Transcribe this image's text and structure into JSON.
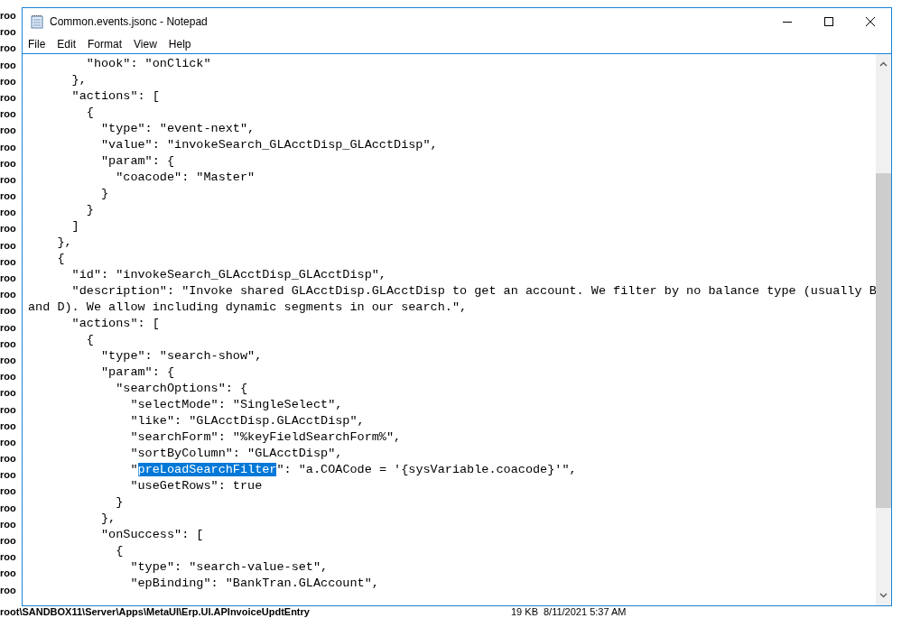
{
  "background_list": {
    "items": [
      "roo",
      "roo",
      "roo",
      "roo",
      "roo",
      "roo",
      "roo",
      "roo",
      "roo",
      "roo",
      "roo",
      "roo",
      "roo",
      "roo",
      "roo",
      "roo",
      "roo",
      "roo",
      "roo",
      "roo",
      "roo",
      "roo",
      "roo",
      "roo",
      "roo",
      "roo",
      "roo",
      "roo",
      "roo",
      "roo",
      "roo",
      "roo",
      "roo",
      "roo",
      "roo",
      "roo"
    ],
    "last_row": {
      "path": "root\\SANDBOX11\\Server\\Apps\\MetaUI\\Erp.UI.APInvoiceUpdtEntry",
      "size": "19 KB",
      "date": "8/11/2021 5:37 AM"
    }
  },
  "window": {
    "title": "Common.events.jsonc - Notepad",
    "menu": [
      "File",
      "Edit",
      "Format",
      "View",
      "Help"
    ],
    "lines": [
      {
        "text": "        \"hook\": \"onClick\""
      },
      {
        "text": "      },"
      },
      {
        "text": "      \"actions\": ["
      },
      {
        "text": "        {"
      },
      {
        "text": "          \"type\": \"event-next\","
      },
      {
        "text": "          \"value\": \"invokeSearch_GLAcctDisp_GLAcctDisp\","
      },
      {
        "text": "          \"param\": {"
      },
      {
        "text": "            \"coacode\": \"Master\""
      },
      {
        "text": "          }"
      },
      {
        "text": "        }"
      },
      {
        "text": "      ]"
      },
      {
        "text": "    },"
      },
      {
        "text": "    {"
      },
      {
        "text": "      \"id\": \"invokeSearch_GLAcctDisp_GLAcctDisp\","
      },
      {
        "text": "      \"description\": \"Invoke shared GLAcctDisp.GLAcctDisp to get an account. We filter by no balance type (usually B"
      },
      {
        "text": "and D). We allow including dynamic segments in our search.\","
      },
      {
        "text": "      \"actions\": ["
      },
      {
        "text": "        {"
      },
      {
        "text": "          \"type\": \"search-show\","
      },
      {
        "text": "          \"param\": {"
      },
      {
        "text": "            \"searchOptions\": {"
      },
      {
        "text": "              \"selectMode\": \"SingleSelect\","
      },
      {
        "text": "              \"like\": \"GLAcctDisp.GLAcctDisp\","
      },
      {
        "text": "              \"searchForm\": \"%keyFieldSearchForm%\","
      },
      {
        "text": "              \"sortByColumn\": \"GLAcctDisp\","
      },
      {
        "segments": [
          {
            "text": "              \"",
            "selected": false
          },
          {
            "text": "preLoadSearchFilter",
            "selected": true
          },
          {
            "text": "\": \"a.COACode = '{sysVariable.coacode}'\",",
            "selected": false
          }
        ]
      },
      {
        "text": "              \"useGetRows\": true"
      },
      {
        "text": "            }"
      },
      {
        "text": "          },"
      },
      {
        "text": "          \"onSuccess\": ["
      },
      {
        "text": "            {"
      },
      {
        "text": "              \"type\": \"search-value-set\","
      },
      {
        "text": "              \"epBinding\": \"BankTran.GLAccount\","
      }
    ]
  }
}
